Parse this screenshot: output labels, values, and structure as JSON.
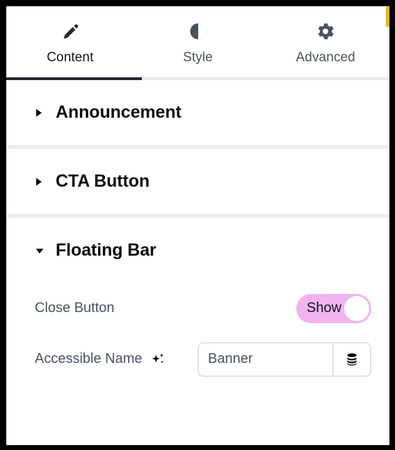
{
  "window": {
    "frame_color": "#000000",
    "background": "#ffffff"
  },
  "tabs": {
    "active": "Content",
    "items": [
      {
        "id": "content",
        "label": "Content",
        "icon": "pencil-icon",
        "active": true
      },
      {
        "id": "style",
        "label": "Style",
        "icon": "contrast-icon",
        "active": false
      },
      {
        "id": "advanced",
        "label": "Advanced",
        "icon": "gear-icon",
        "active": false
      }
    ],
    "active_indicator_color": "#23272f",
    "inactive_label_color": "#4a5160",
    "active_label_color": "#10141c"
  },
  "sections": [
    {
      "id": "announcement",
      "title": "Announcement",
      "expanded": false,
      "caret": "caret-right-icon"
    },
    {
      "id": "cta-button",
      "title": "CTA Button",
      "expanded": false,
      "caret": "caret-right-icon"
    },
    {
      "id": "floating-bar",
      "title": "Floating Bar",
      "expanded": true,
      "caret": "caret-down-icon"
    }
  ],
  "floating_bar": {
    "close_button": {
      "label": "Close Button",
      "toggle_state_label": "Show",
      "enabled": true,
      "track_color": "#f0b4f0",
      "knob_color": "#ffffff"
    },
    "accessible_name": {
      "label": "Accessible Name",
      "ai_icon": "sparkles-icon",
      "value": "Banner",
      "placeholder": "Banner",
      "addon_icon": "database-icon"
    }
  },
  "scrollbar": {
    "thumb_color": "#e9b51f",
    "visible": true
  }
}
